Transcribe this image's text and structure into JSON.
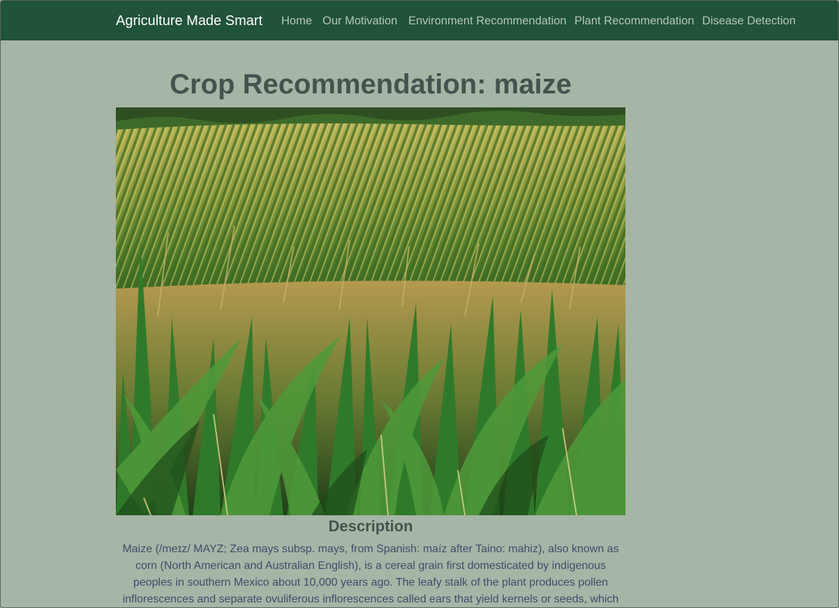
{
  "navbar": {
    "brand": "Agriculture Made Smart",
    "links": [
      "Home",
      "Our Motivation",
      "Environment Recommendation",
      "Plant Recommendation",
      "Disease Detection"
    ]
  },
  "main": {
    "title": "Crop Recommendation: maize",
    "description_heading": "Description",
    "description": "Maize (/meɪz/ MAYZ; Zea mays subsp. mays, from Spanish: maíz after Taino: mahiz), also known as corn (North American and Australian English), is a cereal grain first domesticated by indigenous peoples in southern Mexico about 10,000 years ago. The leafy stalk of the plant produces pollen inflorescences and separate ovuliferous inflorescences called ears that yield kernels or seeds, which"
  },
  "colors": {
    "navbar": "#21523a",
    "background": "#a6b5a6",
    "heading": "#44534d",
    "body_text": "#3d4d6a"
  }
}
